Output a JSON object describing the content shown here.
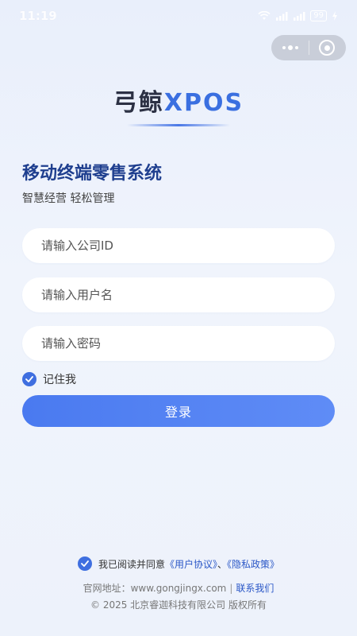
{
  "status_bar": {
    "time": "11:19",
    "battery": "99"
  },
  "logo": {
    "brand_cn": "弓鲸",
    "brand_en": "XPOS"
  },
  "headline": "移动终端零售系统",
  "subline": "智慧经营 轻松管理",
  "form": {
    "company_placeholder": "请输入公司ID",
    "company_value": "",
    "username_placeholder": "请输入用户名",
    "username_value": "",
    "password_placeholder": "请输入密码",
    "password_value": "",
    "remember_label": "记住我",
    "remember_checked": true,
    "login_label": "登录"
  },
  "footer": {
    "agree_prefix": "我已阅读并同意",
    "user_agreement": "《用户协议》",
    "agree_sep": "、",
    "privacy_policy": "《隐私政策》",
    "website_label": "官网地址：www.gongjingx.com",
    "website_sep": "|",
    "contact_label": "联系我们",
    "copyright": "© 2025 北京睿迦科技有限公司 版权所有"
  },
  "colors": {
    "accent": "#4a7af0",
    "headline": "#1f3f8f",
    "link": "#2b57c7",
    "background": "#eef2fb"
  },
  "icons": [
    "wifi-icon",
    "signal-icon",
    "battery-icon",
    "more-icon",
    "close-mini-program-icon",
    "check-icon"
  ]
}
